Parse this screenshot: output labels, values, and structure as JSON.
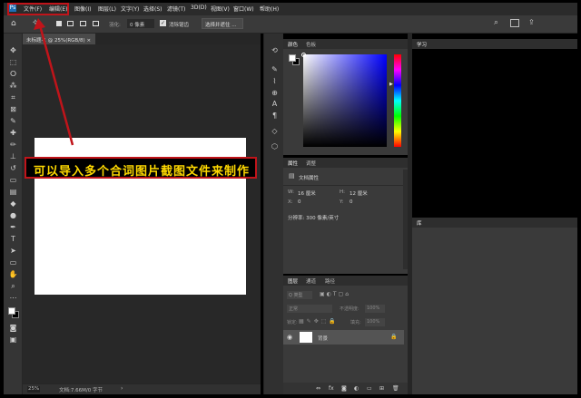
{
  "menu": [
    "文件(F)",
    "编辑(E)",
    "图像(I)",
    "图层(L)",
    "文字(Y)",
    "选择(S)",
    "滤镜(T)",
    "3D(D)",
    "视图(V)",
    "窗口(W)",
    "帮助(H)"
  ],
  "options": {
    "feather_label": "羽化:",
    "feather_value": "0 像素",
    "antialias": "消除锯齿",
    "select_mask": "选择并遮住 ..."
  },
  "document": {
    "tab_label": "未标题-1 @ 25%(RGB/8)",
    "zoom": "25%",
    "doc_info": "文档:7.66M/0 字节"
  },
  "color_panel": {
    "tabs": [
      "颜色",
      "色板"
    ]
  },
  "properties_panel": {
    "tabs": [
      "属性",
      "调整"
    ],
    "title": "文档属性",
    "w_label": "W:",
    "w_value": "16 厘米",
    "h_label": "H:",
    "h_value": "12 厘米",
    "x_label": "X:",
    "x_value": "0",
    "y_label": "Y:",
    "y_value": "0",
    "resolution": "分辨率: 300 像素/英寸"
  },
  "layers_panel": {
    "tabs": [
      "图层",
      "通道",
      "路径"
    ],
    "kind_placeholder": "Q 类型",
    "blend_mode": "正常",
    "opacity_label": "不透明度:",
    "opacity_value": "100%",
    "lock_label": "锁定:",
    "fill_label": "填充:",
    "fill_value": "100%",
    "layer_name": "背景"
  },
  "learn_panel": {
    "tab": "学习"
  },
  "library_panel": {
    "tab": "库"
  },
  "annotation": {
    "text": "可以导入多个合词图片截图文件来制作"
  },
  "colors": {
    "accent": "#c0141a",
    "annotation_text": "#ffd900",
    "foreground": "#ffffff",
    "background": "#000000"
  }
}
